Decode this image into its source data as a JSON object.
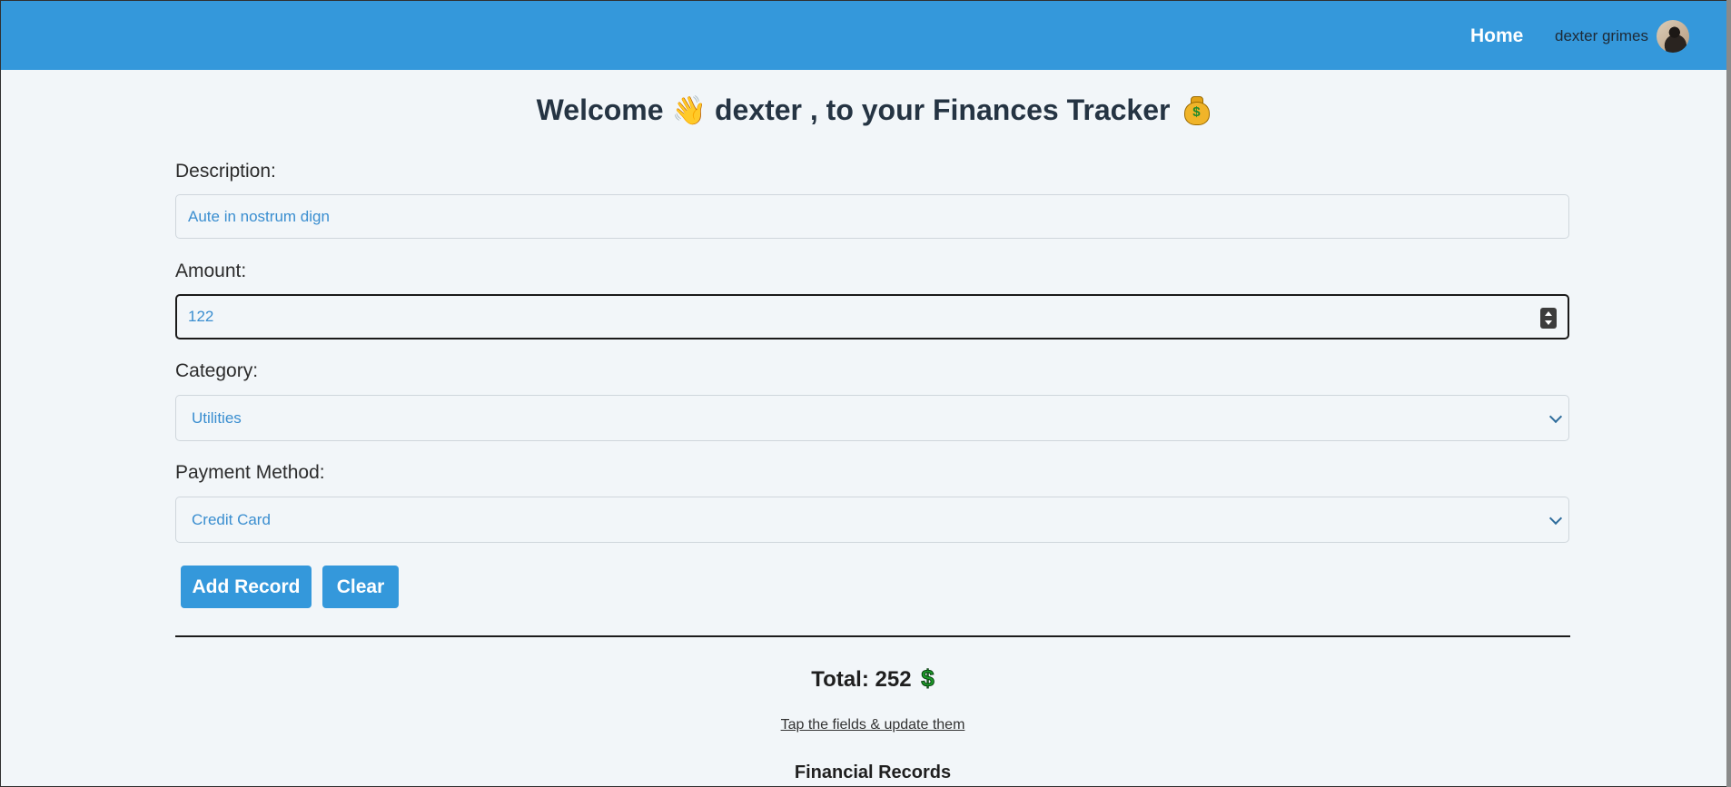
{
  "navbar": {
    "home_label": "Home",
    "user_name": "dexter grimes"
  },
  "welcome": {
    "prefix": "Welcome",
    "wave_emoji": "👋",
    "middle": "dexter , to your Finances Tracker",
    "moneybag_symbol": "$"
  },
  "form": {
    "description_label": "Description:",
    "description_value": "Aute in nostrum dign",
    "amount_label": "Amount:",
    "amount_value": "122",
    "category_label": "Category:",
    "category_value": "Utilities",
    "payment_label": "Payment Method:",
    "payment_value": "Credit Card"
  },
  "buttons": {
    "add_label": "Add Record",
    "clear_label": "Clear"
  },
  "summary": {
    "total_text": "Total: 252",
    "currency_symbol": "$",
    "hint": "Tap the fields & update them",
    "records_title": "Financial Records"
  },
  "colors": {
    "accent": "#3498db",
    "background": "#f2f6f9",
    "input_text": "#3a8ed0"
  }
}
